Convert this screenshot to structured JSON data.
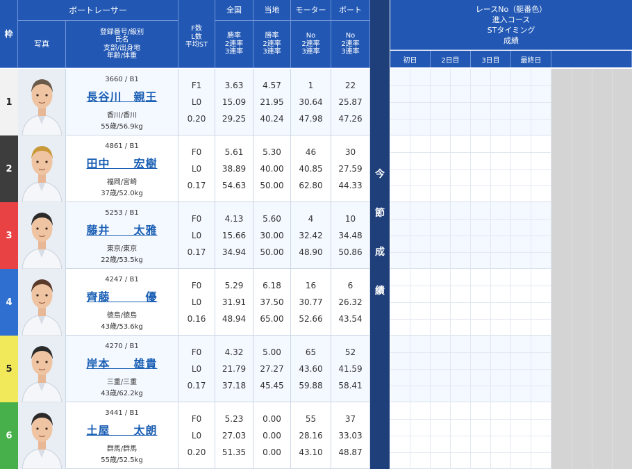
{
  "header": {
    "lane": "枠",
    "racer_group": "ボートレーサー",
    "photo": "写真",
    "info": [
      "登録番号/級別",
      "氏名",
      "支部/出身地",
      "年齢/体重"
    ],
    "f_l_st": [
      "F数",
      "L数",
      "平均ST"
    ],
    "national": {
      "title": "全国",
      "lines": [
        "勝率",
        "2連率",
        "3連率"
      ]
    },
    "local": {
      "title": "当地",
      "lines": [
        "勝率",
        "2連率",
        "3連率"
      ]
    },
    "motor": {
      "title": "モーター",
      "lines": [
        "No",
        "2連率",
        "3連率"
      ]
    },
    "boat": {
      "title": "ボート",
      "lines": [
        "No",
        "2連率",
        "3連率"
      ]
    },
    "results": [
      "レースNo（艇番色）",
      "進入コース",
      "STタイミング",
      "成績"
    ],
    "days": [
      "初日",
      "2日目",
      "3日目",
      "最終日"
    ],
    "band": [
      "今",
      "節",
      "成",
      "績"
    ]
  },
  "colors": {
    "header_blue": "#2258b4",
    "lane1": "#f2f2f2",
    "lane2": "#3d3d3d",
    "lane3": "#e94245",
    "lane4": "#2f6fd0",
    "lane5": "#f2e95a",
    "lane6": "#48b04a"
  },
  "racers": [
    {
      "lane": "1",
      "reg": "3660 / B1",
      "name": "長谷川　親王",
      "branch": "香川/香川",
      "age": "55歳/56.9kg",
      "fl": [
        "F1",
        "L0",
        "0.20"
      ],
      "national": [
        "3.63",
        "15.09",
        "29.25"
      ],
      "local": [
        "4.57",
        "21.95",
        "40.24"
      ],
      "motor": [
        "1",
        "30.64",
        "47.98"
      ],
      "boat": [
        "22",
        "25.87",
        "47.26"
      ]
    },
    {
      "lane": "2",
      "reg": "4861 / B1",
      "name": "田中　　宏樹",
      "branch": "福岡/宮崎",
      "age": "37歳/52.0kg",
      "fl": [
        "F0",
        "L0",
        "0.17"
      ],
      "national": [
        "5.61",
        "38.89",
        "54.63"
      ],
      "local": [
        "5.30",
        "40.00",
        "50.00"
      ],
      "motor": [
        "46",
        "40.85",
        "62.80"
      ],
      "boat": [
        "30",
        "27.59",
        "44.33"
      ]
    },
    {
      "lane": "3",
      "reg": "5253 / B1",
      "name": "藤井　　太雅",
      "branch": "東京/東京",
      "age": "22歳/53.5kg",
      "fl": [
        "F0",
        "L0",
        "0.17"
      ],
      "national": [
        "4.13",
        "15.66",
        "34.94"
      ],
      "local": [
        "5.60",
        "30.00",
        "50.00"
      ],
      "motor": [
        "4",
        "32.42",
        "48.90"
      ],
      "boat": [
        "10",
        "34.48",
        "50.86"
      ]
    },
    {
      "lane": "4",
      "reg": "4247 / B1",
      "name": "齊藤　　　優",
      "branch": "徳島/徳島",
      "age": "43歳/53.6kg",
      "fl": [
        "F0",
        "L0",
        "0.16"
      ],
      "national": [
        "5.29",
        "31.91",
        "48.94"
      ],
      "local": [
        "6.18",
        "37.50",
        "65.00"
      ],
      "motor": [
        "16",
        "30.77",
        "52.66"
      ],
      "boat": [
        "6",
        "26.32",
        "43.54"
      ]
    },
    {
      "lane": "5",
      "reg": "4270 / B1",
      "name": "岸本　　雄貴",
      "branch": "三重/三重",
      "age": "43歳/62.2kg",
      "fl": [
        "F0",
        "L0",
        "0.17"
      ],
      "national": [
        "4.32",
        "21.79",
        "37.18"
      ],
      "local": [
        "5.00",
        "27.27",
        "45.45"
      ],
      "motor": [
        "65",
        "43.60",
        "59.88"
      ],
      "boat": [
        "52",
        "41.59",
        "58.41"
      ]
    },
    {
      "lane": "6",
      "reg": "3441 / B1",
      "name": "土屋　　太朗",
      "branch": "群馬/群馬",
      "age": "55歳/52.5kg",
      "fl": [
        "F0",
        "L0",
        "0.20"
      ],
      "national": [
        "5.23",
        "27.03",
        "51.35"
      ],
      "local": [
        "0.00",
        "0.00",
        "0.00"
      ],
      "motor": [
        "55",
        "28.16",
        "43.10"
      ],
      "boat": [
        "37",
        "33.03",
        "48.87"
      ]
    }
  ]
}
